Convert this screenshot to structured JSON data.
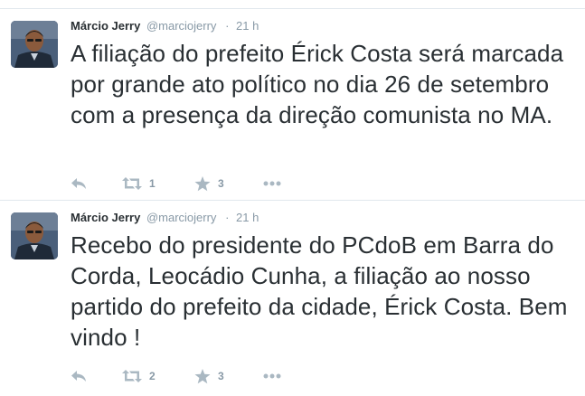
{
  "tweets": [
    {
      "author": {
        "name": "Márcio Jerry",
        "handle": "@marciojerry",
        "separator": "·",
        "time": "21 h"
      },
      "text": "A filiação do prefeito Érick Costa será marcada por grande ato político no dia 26 de setembro com a presença da direção comunista no MA.",
      "actions": {
        "reply_icon": "reply-icon",
        "retweet_icon": "retweet-icon",
        "retweet_count": "1",
        "favorite_icon": "star-icon",
        "favorite_count": "3",
        "more_icon": "more-dots-icon"
      }
    },
    {
      "author": {
        "name": "Márcio Jerry",
        "handle": "@marciojerry",
        "separator": "·",
        "time": "21 h"
      },
      "text": "Recebo do presidente do PCdoB em Barra do Corda, Leocádio Cunha, a filiação ao nosso partido do prefeito da cidade, Érick Costa. Bem vindo !",
      "actions": {
        "reply_icon": "reply-icon",
        "retweet_icon": "retweet-icon",
        "retweet_count": "2",
        "favorite_icon": "star-icon",
        "favorite_count": "3",
        "more_icon": "more-dots-icon"
      }
    }
  ],
  "colors": {
    "text": "#292f33",
    "muted": "#8899a6",
    "icon": "#aab8c2",
    "divider": "#e1e8ed"
  }
}
